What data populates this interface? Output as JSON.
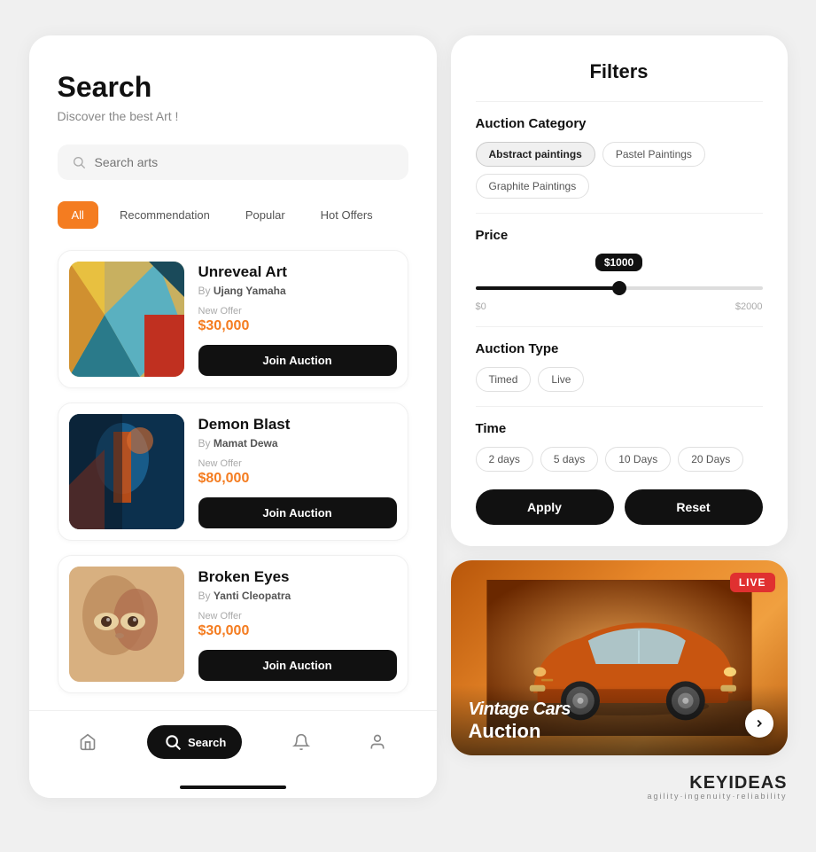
{
  "left": {
    "title": "Search",
    "subtitle": "Discover the best Art !",
    "search_placeholder": "Search arts",
    "filter_tabs": [
      {
        "label": "All",
        "active": true
      },
      {
        "label": "Recommendation",
        "active": false
      },
      {
        "label": "Popular",
        "active": false
      },
      {
        "label": "Hot Offers",
        "active": false
      }
    ],
    "art_items": [
      {
        "name": "Unreveal  Art",
        "author_prefix": "By",
        "author": "Ujang Yamaha",
        "offer_label": "New Offer",
        "price": "$30,000",
        "btn_label": "Join Auction",
        "thumb_class": "art-thumb-1"
      },
      {
        "name": "Demon Blast",
        "author_prefix": "By",
        "author": "Mamat Dewa",
        "offer_label": "New Offer",
        "price": "$80,000",
        "btn_label": "Join Auction",
        "thumb_class": "art-thumb-2"
      },
      {
        "name": "Broken Eyes",
        "author_prefix": "By",
        "author": "Yanti Cleopatra",
        "offer_label": "New Offer",
        "price": "$30,000",
        "btn_label": "Join Auction",
        "thumb_class": "art-thumb-3"
      }
    ],
    "bottom_nav": [
      {
        "label": "",
        "icon": "home-icon",
        "active": false
      },
      {
        "label": "Search",
        "icon": "search-icon",
        "active": true
      },
      {
        "label": "",
        "icon": "bell-icon",
        "active": false
      },
      {
        "label": "",
        "icon": "user-icon",
        "active": false
      }
    ]
  },
  "right": {
    "filters": {
      "title": "Filters",
      "sections": [
        {
          "id": "auction-category",
          "label": "Auction Category",
          "chips": [
            {
              "label": "Abstract paintings",
              "active": true
            },
            {
              "label": "Pastel Paintings",
              "active": false
            },
            {
              "label": "Graphite Paintings",
              "active": false
            }
          ]
        },
        {
          "id": "price",
          "label": "Price",
          "min": "$0",
          "max": "$2000",
          "current": "$1000",
          "value": 50
        },
        {
          "id": "auction-type",
          "label": "Auction Type",
          "chips": [
            {
              "label": "Timed",
              "active": false
            },
            {
              "label": "Live",
              "active": false
            }
          ]
        },
        {
          "id": "time",
          "label": "Time",
          "chips": [
            {
              "label": "2 days",
              "active": false
            },
            {
              "label": "5 days",
              "active": false
            },
            {
              "label": "10 Days",
              "active": false
            },
            {
              "label": "20 Days",
              "active": false
            }
          ]
        }
      ],
      "apply_label": "Apply",
      "reset_label": "Reset"
    },
    "live_auction": {
      "badge": "LIVE",
      "title_main": "Vintage Cars",
      "title_sub": "Auction",
      "next_icon": "chevron-right-icon"
    },
    "brand": {
      "name": "KEYIDEAS",
      "tagline": "agility·ingenuity·reliability"
    }
  }
}
